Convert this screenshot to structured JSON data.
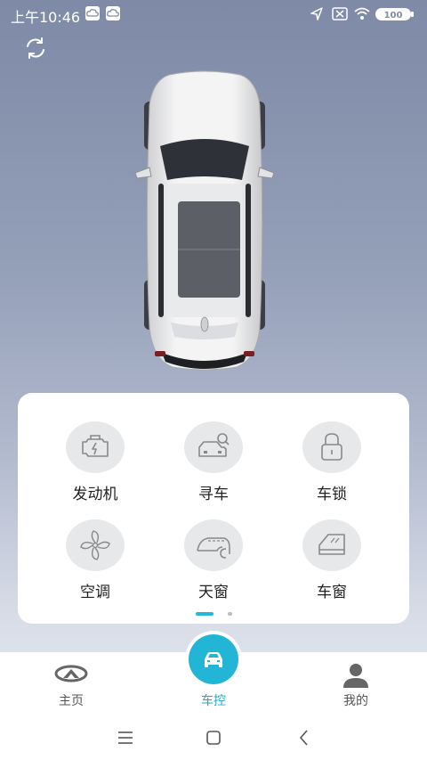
{
  "status_bar": {
    "time": "上午10:46",
    "battery": "100",
    "icons": [
      "cloud-app-icon",
      "cloud-app-icon",
      "location-arrow-icon",
      "sim-x-icon",
      "wifi-icon",
      "battery-icon"
    ]
  },
  "header": {
    "refresh_icon": "refresh-icon"
  },
  "controls": {
    "items": [
      {
        "label": "发动机",
        "icon": "engine-icon"
      },
      {
        "label": "寻车",
        "icon": "find-car-icon"
      },
      {
        "label": "车锁",
        "icon": "lock-icon"
      },
      {
        "label": "空调",
        "icon": "fan-icon"
      },
      {
        "label": "天窗",
        "icon": "sunroof-icon"
      },
      {
        "label": "车窗",
        "icon": "window-icon"
      }
    ],
    "page_indicator": {
      "current": 1,
      "total": 2
    }
  },
  "bottom_nav": {
    "items": [
      {
        "label": "主页",
        "icon": "brand-logo-icon"
      },
      {
        "label": "车控",
        "icon": "car-control-icon",
        "active": true
      },
      {
        "label": "我的",
        "icon": "user-icon"
      }
    ]
  },
  "colors": {
    "accent": "#22b5d6",
    "panel": "#ffffff",
    "icon_bg": "#e7e8ea"
  }
}
